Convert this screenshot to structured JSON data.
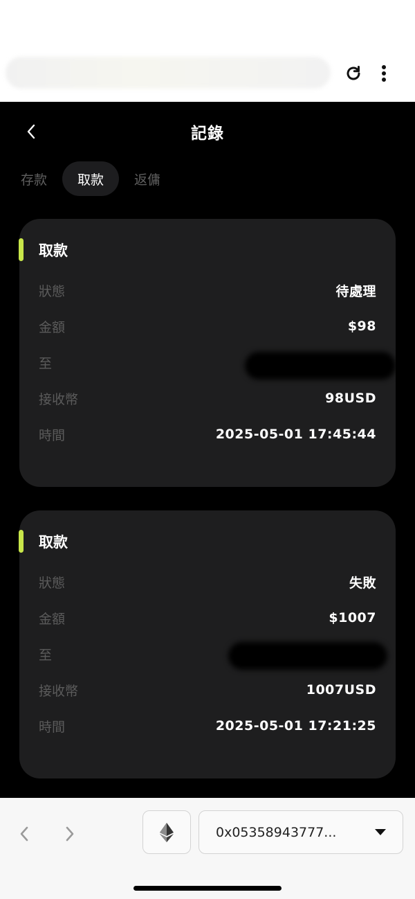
{
  "header": {
    "title": "記錄"
  },
  "tabs": [
    {
      "label": "存款",
      "active": false
    },
    {
      "label": "取款",
      "active": true
    },
    {
      "label": "返傭",
      "active": false
    }
  ],
  "records": [
    {
      "title": "取款",
      "rows": [
        {
          "label": "狀態",
          "value": "待處理"
        },
        {
          "label": "金額",
          "value": "$98"
        },
        {
          "label": "至",
          "value": ""
        },
        {
          "label": "接收幣",
          "value": "98USD"
        },
        {
          "label": "時間",
          "value": "2025-05-01 17:45:44"
        }
      ]
    },
    {
      "title": "取款",
      "rows": [
        {
          "label": "狀態",
          "value": "失敗"
        },
        {
          "label": "金額",
          "value": "$1007"
        },
        {
          "label": "至",
          "value": ""
        },
        {
          "label": "接收幣",
          "value": "1007USD"
        },
        {
          "label": "時間",
          "value": "2025-05-01 17:21:25"
        }
      ]
    }
  ],
  "toolbar": {
    "wallet_address": "0x05358943777..."
  },
  "colors": {
    "accent": "#c8e64a",
    "app_background": "#000000",
    "card_background": "#1e1e1f"
  },
  "icons": {
    "reload": "reload-icon",
    "more": "more-vertical-icon",
    "back": "chevron-left-icon",
    "eth": "ethereum-icon",
    "dropdown": "caret-down-icon"
  }
}
